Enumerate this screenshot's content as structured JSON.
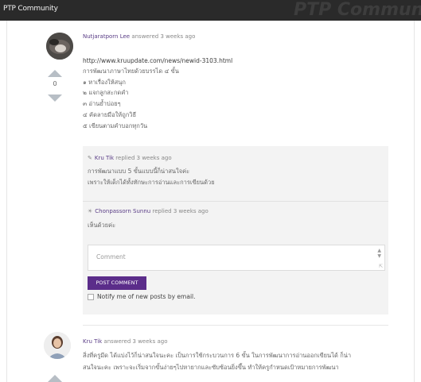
{
  "window": {
    "title": "PTP Community",
    "logo_text": "PTP Communi"
  },
  "answers": [
    {
      "author": "Nutjaratporn Lee",
      "action": " answered 3 weeks ago",
      "votes": "0",
      "lines": [
        "http://www.kruupdate.com/news/newid-3103.html",
        "การพัฒนาภาษาไทยด้วยบรรได ๔ ขั้น",
        "๑ หาเรื่องให้สนุก",
        "๒ แจกลูกสะกดคำ",
        "๓ อ่านย้ำบ่อยๆ",
        "๔ คัดลายมือให้ถูกวิธี",
        "๕ เขียนตามคำบอกทุกวัน"
      ],
      "replies": [
        {
          "icon": "user-icon",
          "author": "Kru Tik",
          "action": " replied 3 weeks ago",
          "lines": [
            "การพัฒนาแบบ 5 ขั้นแบบนี้ก็น่าสนใจค่ะ",
            "เพราะให้เด็กได้ทั้งทักษะการอ่านและการเขียนด้วย"
          ]
        },
        {
          "icon": "sun-icon",
          "author": "Chonpassorn Sunnu",
          "action": " replied 3 weeks ago",
          "lines": [
            "เห็นด้วยค่ะ"
          ]
        }
      ],
      "comment_placeholder": "Comment",
      "post_button": "POST COMMENT",
      "notify_label": "Notify me of new posts by email."
    },
    {
      "author": "Kru Tik",
      "action": " answered 3 weeks ago",
      "lines": [
        "สิ่งที่ครูมีด ได้แบ่งไว้ก็น่าสนใจนะคะ เป็นการใช้กระบวนการ 6 ขั้น ในการพัฒนาการอ่านออกเขียนได้ ก็น่า",
        "สนใจนะคะ เพราะจะเริ่มจากขั้นง่ายๆไปหายากและซับซ้อนยิ่งขึ้น ทำให้ครูกำหนดเป้าหมายการพัฒนา"
      ]
    }
  ],
  "colors": {
    "topbar": "#2a2a2a",
    "accent": "#5b2d8a",
    "reply_bg": "#f3f3f3"
  }
}
